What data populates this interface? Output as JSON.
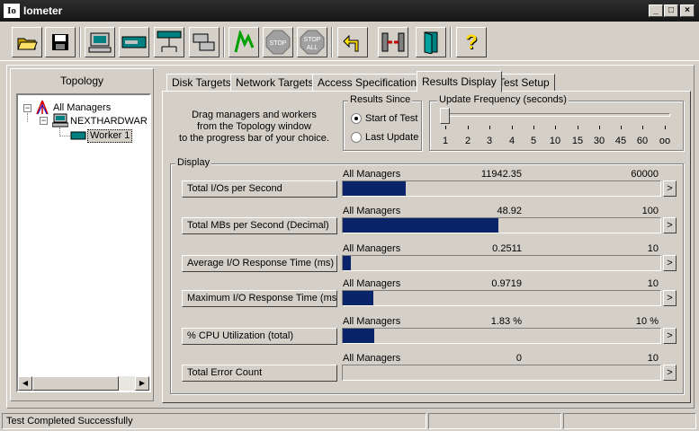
{
  "window": {
    "title": "Iometer",
    "app_icon_text": "Io",
    "minimize": "_",
    "maximize": "□",
    "close": "×"
  },
  "toolbar": {
    "buttons": [
      {
        "icon": "open-folder-icon"
      },
      {
        "icon": "save-disk-icon"
      },
      {
        "icon": "new-manager-icon"
      },
      {
        "icon": "new-disk-worker-icon"
      },
      {
        "icon": "new-network-worker-icon"
      },
      {
        "icon": "duplicate-worker-icon"
      },
      {
        "icon": "start-green-flag-icon"
      },
      {
        "icon": "stop-icon"
      },
      {
        "icon": "stop-all-icon"
      },
      {
        "icon": "reset-arrow-icon"
      },
      {
        "icon": "disconnect-icon"
      },
      {
        "icon": "exit-door-icon"
      },
      {
        "icon": "help-question-icon"
      }
    ],
    "stop_label": "STOP",
    "stop_all_label": "STOP",
    "stop_all_sub": "ALL",
    "help_label": "?"
  },
  "topology": {
    "title": "Topology",
    "root": "All Managers",
    "manager": "NEXTHARDWAR",
    "worker": "Worker 1",
    "expand_symbol": "−"
  },
  "tabs": [
    {
      "label": "Disk Targets"
    },
    {
      "label": "Network Targets"
    },
    {
      "label": "Access Specifications"
    },
    {
      "label": "Results Display"
    },
    {
      "label": "Test Setup"
    }
  ],
  "results": {
    "drag_text": [
      "Drag managers and workers",
      "from the Topology window",
      "to the progress bar of your choice."
    ],
    "results_since": {
      "title": "Results Since",
      "options": [
        "Start of Test",
        "Last Update"
      ],
      "selected": 0
    },
    "update_frequency": {
      "title": "Update Frequency (seconds)",
      "ticks": [
        "1",
        "2",
        "3",
        "4",
        "5",
        "10",
        "15",
        "30",
        "45",
        "60",
        "oo"
      ]
    },
    "display_title": "Display",
    "rows": [
      {
        "label": "Total I/Os per Second",
        "source": "All Managers",
        "value": "11942.35",
        "max": "60000",
        "fraction": 0.199
      },
      {
        "label": "Total MBs per Second (Decimal)",
        "source": "All Managers",
        "value": "48.92",
        "max": "100",
        "fraction": 0.489
      },
      {
        "label": "Average I/O Response Time (ms)",
        "source": "All Managers",
        "value": "0.2511",
        "max": "10",
        "fraction": 0.025
      },
      {
        "label": "Maximum I/O Response Time (ms)",
        "source": "All Managers",
        "value": "0.9719",
        "max": "10",
        "fraction": 0.097
      },
      {
        "label": "% CPU Utilization (total)",
        "source": "All Managers",
        "value": "1.83 %",
        "max": "10 %",
        "fraction": 0.1
      },
      {
        "label": "Total Error Count",
        "source": "All Managers",
        "value": "0",
        "max": "10",
        "fraction": 0
      }
    ],
    "arrow": ">"
  },
  "status": {
    "text": "Test Completed Successfully"
  },
  "colors": {
    "bar_fill": "#0a246a",
    "titlebar": "#1f1f1f"
  }
}
